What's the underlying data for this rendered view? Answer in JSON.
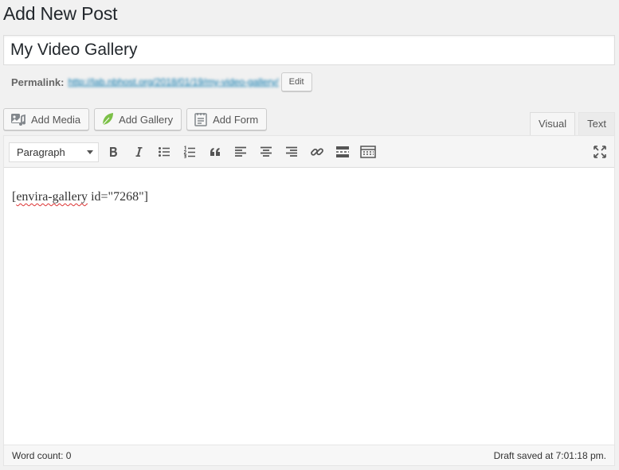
{
  "page": {
    "heading": "Add New Post"
  },
  "post": {
    "title": "My Video Gallery"
  },
  "permalink": {
    "label": "Permalink:",
    "url": "http://lab.nbhost.org/2018/01/19/my-video-gallery/",
    "edit_label": "Edit"
  },
  "media_buttons": {
    "add_media": "Add Media",
    "add_gallery": "Add Gallery",
    "add_form": "Add Form"
  },
  "editor_tabs": {
    "visual": "Visual",
    "text": "Text",
    "active": "Visual"
  },
  "toolbar": {
    "format_value": "Paragraph",
    "icons": [
      "bold-icon",
      "italic-icon",
      "bulleted-list-icon",
      "numbered-list-icon",
      "blockquote-icon",
      "align-left-icon",
      "align-center-icon",
      "align-right-icon",
      "link-icon",
      "read-more-icon",
      "toolbar-toggle-icon",
      "fullscreen-icon"
    ]
  },
  "content": {
    "word_spellcheck": "envira-gallery",
    "prefix": "[",
    "suffix": " id=\"7268\"]"
  },
  "status": {
    "word_count": "Word count: 0",
    "draft_saved": "Draft saved at 7:01:18 pm."
  },
  "colors": {
    "accent": "#0073aa",
    "gallery_leaf": "#7cc048",
    "background": "#f1f1f1"
  }
}
